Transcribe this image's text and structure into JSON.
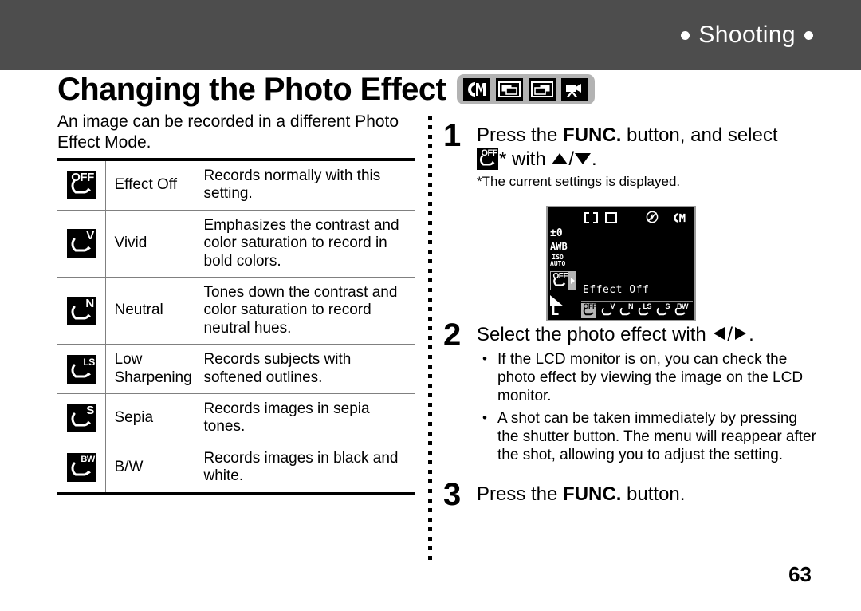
{
  "header": {
    "section_label": "Shooting",
    "bullet_glyph": "dot",
    "bar_color": "#4d4d4d",
    "text_color": "#ffffff"
  },
  "title": {
    "text": "Changing the Photo Effect",
    "mode_badge_color": "#b3b3b3",
    "mode_icons": [
      {
        "name": "mode-icon-manual-cm",
        "label": "CM"
      },
      {
        "name": "mode-icon-stitch-assist-left",
        "label": "Stitch Assist"
      },
      {
        "name": "mode-icon-stitch-assist-right",
        "label": "Stitch Assist"
      },
      {
        "name": "mode-icon-movie",
        "label": "Movie"
      }
    ]
  },
  "intro": "An image can be recorded in a different Photo Effect Mode.",
  "table": {
    "rows": [
      {
        "icon_label": "OFF",
        "icon_name": "photo-effect-off-icon",
        "name": "Effect Off",
        "description": "Records normally with this setting."
      },
      {
        "icon_label": "V",
        "icon_name": "photo-effect-vivid-icon",
        "name": "Vivid",
        "description": "Emphasizes the contrast and color saturation to record in bold colors."
      },
      {
        "icon_label": "N",
        "icon_name": "photo-effect-neutral-icon",
        "name": "Neutral",
        "description": "Tones down the contrast and color saturation to record neutral hues."
      },
      {
        "icon_label": "LS",
        "icon_name": "photo-effect-low-sharpening-icon",
        "name": "Low Sharpening",
        "description": "Records subjects with softened outlines."
      },
      {
        "icon_label": "S",
        "icon_name": "photo-effect-sepia-icon",
        "name": "Sepia",
        "description": "Records images in sepia tones."
      },
      {
        "icon_label": "BW",
        "icon_name": "photo-effect-bw-icon",
        "name": "B/W",
        "description": "Records images in black and white."
      }
    ]
  },
  "steps": {
    "step1": {
      "number": "1",
      "text_before": "Press the ",
      "bold": "FUNC.",
      "text_middle": " button, and select",
      "text_after_icon": "* with ",
      "text_end": ".",
      "footnote": "*The current settings is displayed.",
      "icon_label": "OFF",
      "up_arrow": "up-triangle",
      "down_arrow": "down-triangle",
      "separator": "/"
    },
    "step2": {
      "number": "2",
      "text_before": "Select the photo effect with ",
      "text_end": ".",
      "left_arrow": "left-triangle",
      "right_arrow": "right-triangle",
      "separator": "/",
      "bullets": [
        "If the LCD monitor is on, you can check the photo effect by viewing the image on the LCD monitor.",
        "A shot can be taken immediately by pressing the shutter button. The menu will reappear after the shot, allowing you to adjust the setting."
      ]
    },
    "step3": {
      "number": "3",
      "text_before": "Press the ",
      "bold": "FUNC.",
      "text_end": " button."
    }
  },
  "lcd": {
    "top_icons": [
      {
        "name": "af-frame-bracket-icon"
      },
      {
        "name": "af-frame-square-icon"
      },
      {
        "name": "flash-off-icon"
      },
      {
        "name": "mode-cm-icon",
        "label": "CM"
      }
    ],
    "exposure": "±0",
    "white_balance": "AWB",
    "iso_label": "ISO",
    "iso_value": "AUTO",
    "selected_effect_label": "OFF",
    "quality_icon": "compression-fine-icon",
    "resolution": "L",
    "effect_name": "Effect Off",
    "effect_strip": [
      {
        "label": "OFF",
        "selected": true
      },
      {
        "label": "V",
        "selected": false
      },
      {
        "label": "N",
        "selected": false
      },
      {
        "label": "LS",
        "selected": false
      },
      {
        "label": "S",
        "selected": false
      },
      {
        "label": "BW",
        "selected": false
      }
    ]
  },
  "page_number": "63"
}
